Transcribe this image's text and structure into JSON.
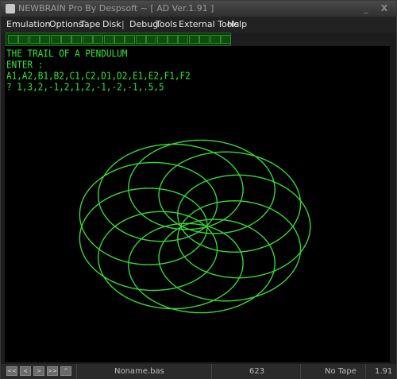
{
  "window": {
    "title": "NEWBRAIN Pro By Despsoft ~ [ AD Ver.1.91 ]",
    "minimize_glyph": "_",
    "close_glyph": "X"
  },
  "menu": {
    "items": [
      "Emulation",
      "Options",
      "Tape",
      "Disk",
      "|",
      "Debug",
      "Tools",
      "External Tools",
      "Help"
    ]
  },
  "screen": {
    "lines": [
      "THE TRAIL OF A PENDULUM",
      "ENTER :",
      "A1,A2,B1,B2,C1,C2,D1,D2,E1,E2,F1,F2",
      "? 1,3,2,-1,2,1,2,-1,-2,-1,.5,5"
    ],
    "text_color": "#34e834",
    "plot_color": "#3ad63a"
  },
  "status": {
    "buttons": [
      "<<",
      "<",
      ">",
      ">>",
      "^"
    ],
    "file": "Noname.bas",
    "counter": "623",
    "tape": "No Tape",
    "version": "1.91"
  }
}
